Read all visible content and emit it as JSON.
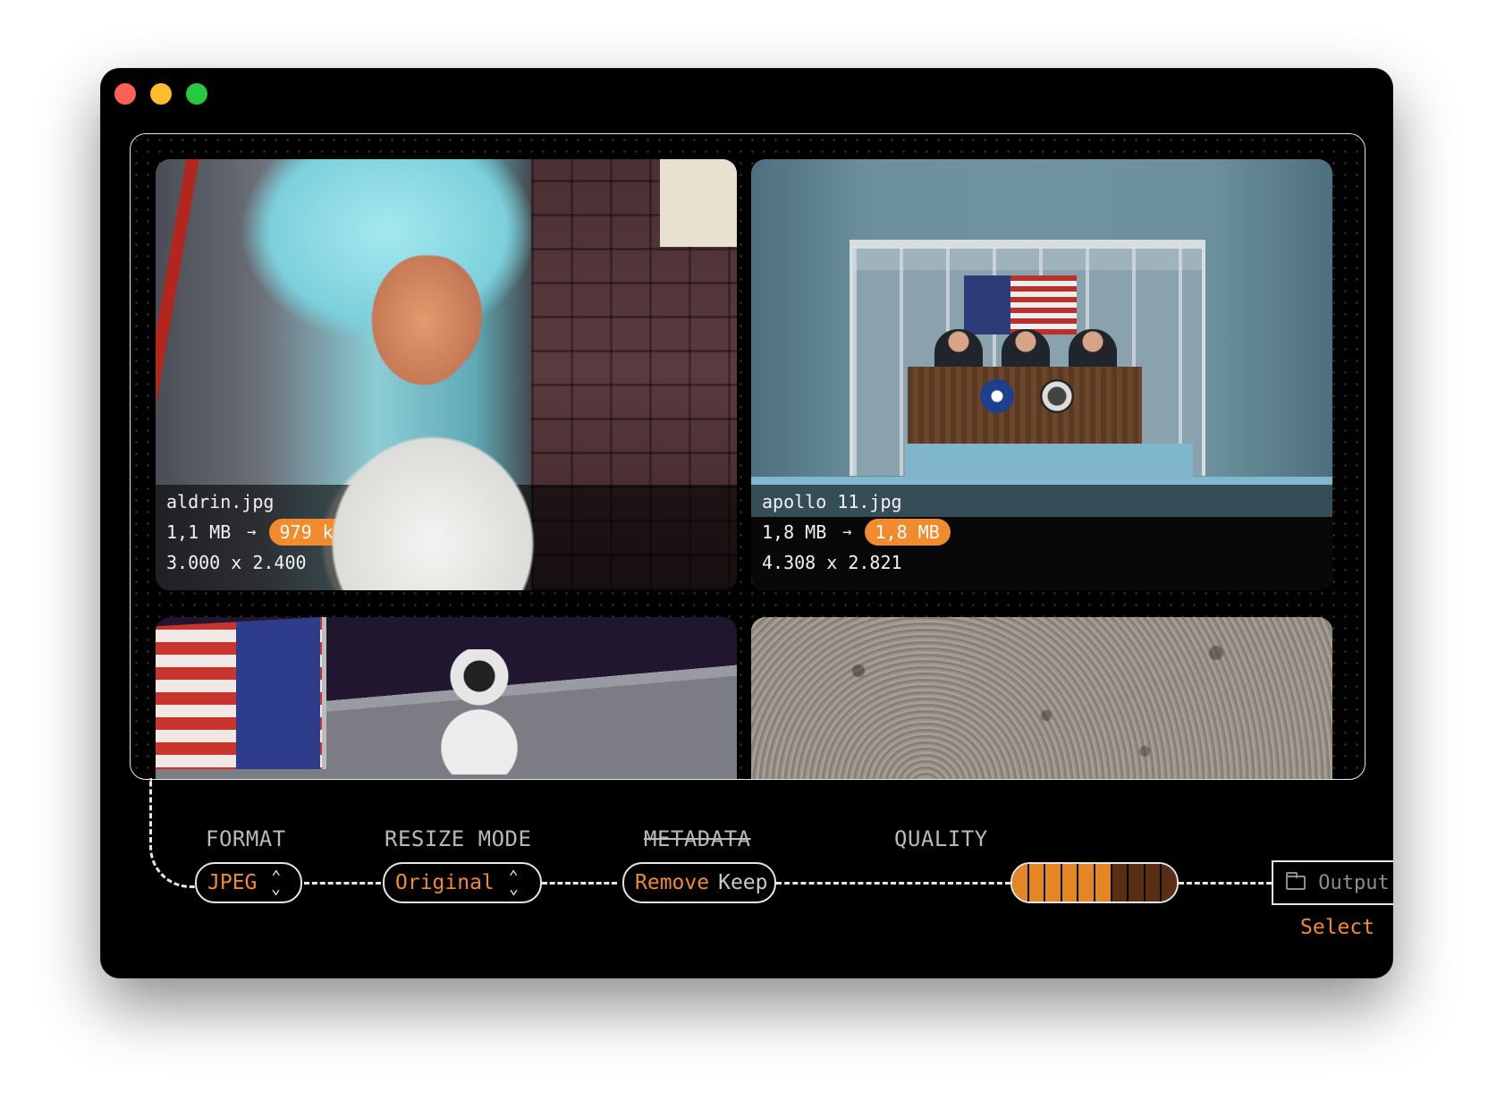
{
  "images": [
    {
      "filename": "aldrin.jpg",
      "original_size": "1,1 MB",
      "new_size": "979 kB",
      "dimensions": "3.000 x 2.400"
    },
    {
      "filename": "apollo 11.jpg",
      "original_size": "1,8 MB",
      "new_size": "1,8 MB",
      "dimensions": "4.308 x 2.821"
    },
    {
      "filename": "",
      "original_size": "",
      "new_size": "",
      "dimensions": ""
    },
    {
      "filename": "",
      "original_size": "",
      "new_size": "",
      "dimensions": ""
    }
  ],
  "controls": {
    "format": {
      "label": "FORMAT",
      "value": "JPEG"
    },
    "resize_mode": {
      "label": "RESIZE MODE",
      "value": "Original"
    },
    "metadata": {
      "label": "METADATA",
      "option_active": "Remove",
      "option_inactive": "Keep"
    },
    "quality": {
      "label": "QUALITY",
      "level_fraction": 0.6
    },
    "output": {
      "placeholder": "Output",
      "select_label": "Select"
    }
  },
  "colors": {
    "accent": "#f28a2e",
    "window_bg": "#000000",
    "border": "#e6e6e6"
  },
  "icons": {
    "updown": "chevron-updown-icon",
    "folder": "folder-icon",
    "run": "play-icon"
  }
}
